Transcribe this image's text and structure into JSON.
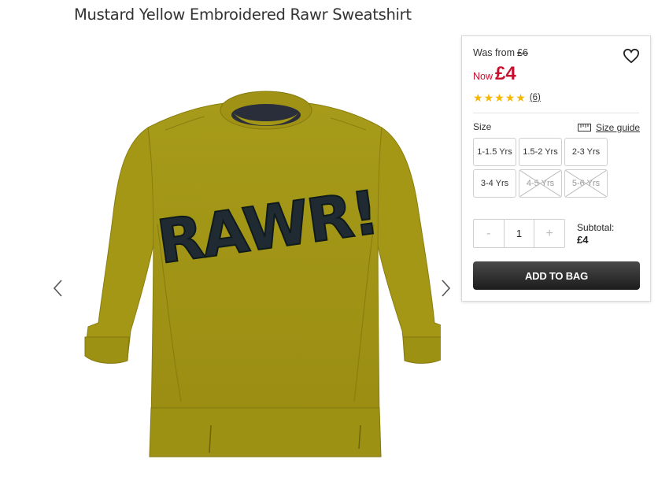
{
  "product": {
    "title": "Mustard Yellow Embroidered Rawr Sweatshirt",
    "image_text": "RAWR!"
  },
  "gallery": {
    "prev_icon": "chevron-left-icon",
    "next_icon": "chevron-right-icon"
  },
  "pricing": {
    "was_label": "Was from",
    "was_price": "£6",
    "now_label": "Now",
    "now_price": "£4",
    "sale_color": "#c8102e"
  },
  "rating": {
    "stars": 5,
    "count": "(6)",
    "star_color": "#f5b700"
  },
  "sizes": {
    "label": "Size",
    "guide_label": "Size guide",
    "options": [
      {
        "label": "1-1.5 Yrs",
        "available": true
      },
      {
        "label": "1.5-2 Yrs",
        "available": true
      },
      {
        "label": "2-3 Yrs",
        "available": true
      },
      {
        "label": "3-4 Yrs",
        "available": true
      },
      {
        "label": "4-5 Yrs",
        "available": false
      },
      {
        "label": "5-6 Yrs",
        "available": false
      }
    ]
  },
  "quantity": {
    "minus": "-",
    "value": "1",
    "plus": "+"
  },
  "subtotal": {
    "label": "Subtotal:",
    "amount": "£4"
  },
  "cta": {
    "add_to_bag": "ADD TO BAG"
  }
}
